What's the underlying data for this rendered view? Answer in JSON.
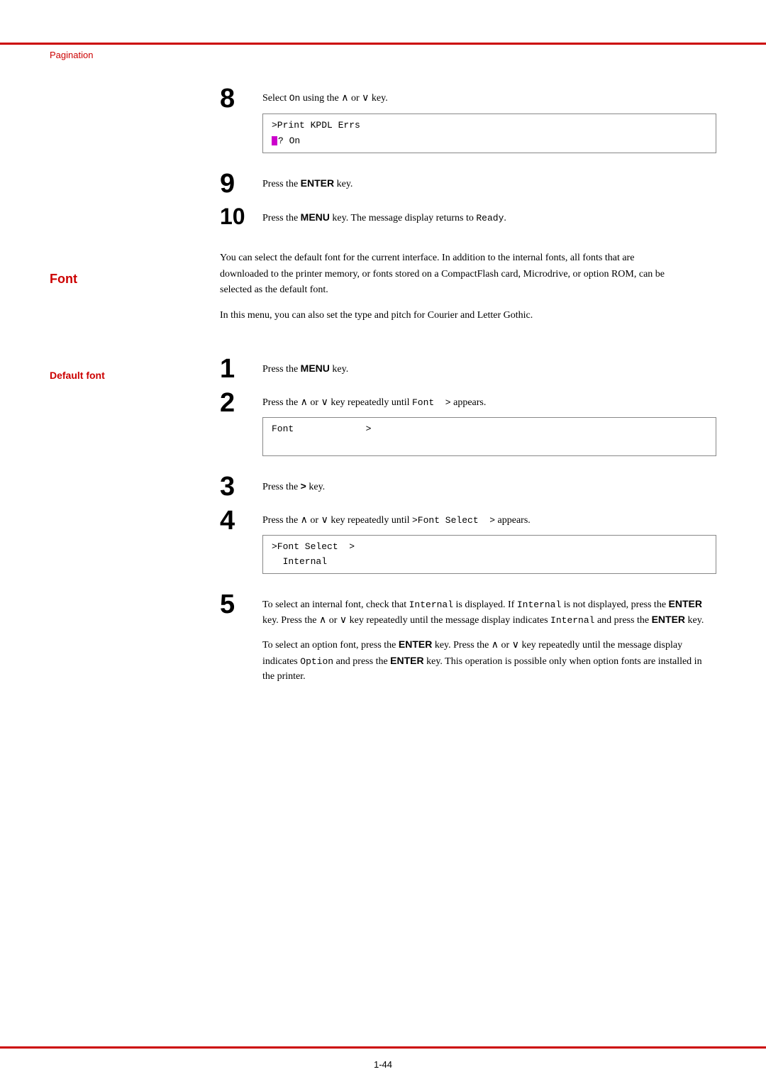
{
  "page": {
    "header": {
      "section_label": "Pagination"
    },
    "footer": {
      "page_number": "1-44"
    },
    "steps_top": [
      {
        "number": "8",
        "text": "Select On using the ∧ or ∨ key.",
        "code_box": [
          ">Print KPDL Errs",
          "? On"
        ]
      },
      {
        "number": "9",
        "text": "Press the ENTER key."
      },
      {
        "number": "10",
        "text": "Press the MENU key. The message display returns to Ready."
      }
    ],
    "font_section": {
      "heading": "Font",
      "paragraphs": [
        "You can select the default font for the current interface. In addition to the internal fonts, all fonts that are downloaded to the printer memory, or fonts stored on a CompactFlash card, Microdrive, or option ROM, can be selected as the default font.",
        "In this menu, you can also set the type and pitch for Courier and Letter Gothic."
      ]
    },
    "default_font_section": {
      "heading": "Default font",
      "steps": [
        {
          "number": "1",
          "text": "Press the MENU key."
        },
        {
          "number": "2",
          "text": "Press the ∧ or ∨ key repeatedly until Font  > appears.",
          "code_box": [
            "Font             >",
            ""
          ]
        },
        {
          "number": "3",
          "text": "Press the > key."
        },
        {
          "number": "4",
          "text": "Press the ∧ or ∨ key repeatedly until >Font Select  > appears.",
          "code_box": [
            ">Font Select   >",
            "  Internal"
          ]
        },
        {
          "number": "5",
          "text_parts": [
            "To select an internal font, check that Internal is displayed. If Internal is not displayed, press the ENTER key. Press the ∧ or ∨ key repeatedly until the message display indicates Internal and press the ENTER key.",
            "To select an option font, press the ENTER key. Press the ∧ or ∨ key repeatedly until the message display indicates Option and press the ENTER key. This operation is possible only when option fonts are installed in the printer."
          ]
        }
      ]
    }
  }
}
